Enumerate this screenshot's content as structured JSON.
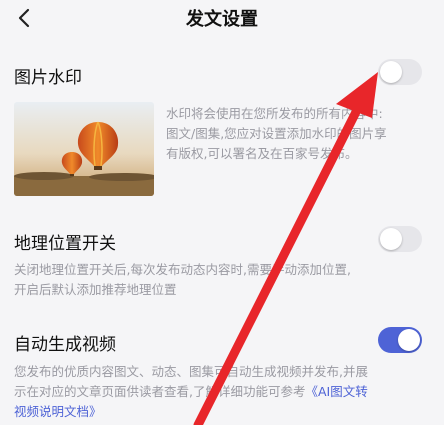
{
  "header": {
    "title": "发文设置"
  },
  "watermark": {
    "title": "图片水印",
    "enabled": false,
    "desc_lines": [
      "水印将会使用在您所发布的所有内容中:",
      "图文/图集,您应对设置添加水印的图片享",
      "有版权,可以署名及在百家号发布。"
    ]
  },
  "location": {
    "title": "地理位置开关",
    "enabled": false,
    "desc_lines": [
      "关闭地理位置开关后,每次发布动态内容时,需要手动添加位置,",
      "开启后默认添加推荐地理位置"
    ]
  },
  "video": {
    "title": "自动生成视频",
    "enabled": true,
    "desc_line1": "您发布的优质内容图文、动态、图集可自动生成视频并发布,并展",
    "desc_line2_text": "示在对应的文章页面供读者查看,了解详细功能可参考",
    "desc_line2_link": "《AI图文转",
    "desc_line3_link": "视频说明文档》"
  },
  "icons": {
    "back": "chevron-left-icon",
    "arrow": "red-arrow-annotation"
  }
}
